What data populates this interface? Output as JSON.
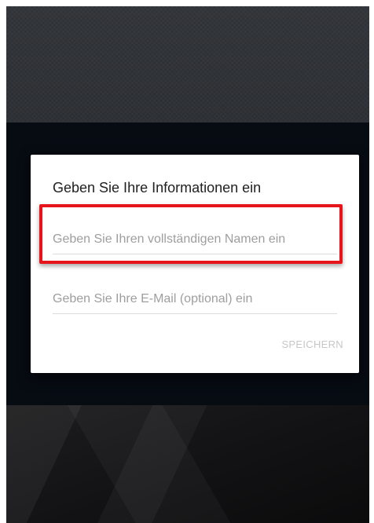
{
  "dialog": {
    "title": "Geben Sie Ihre Informationen ein",
    "name_field": {
      "value": "",
      "placeholder": "Geben Sie Ihren vollständigen Namen ein"
    },
    "email_field": {
      "value": "",
      "placeholder": "Geben Sie Ihre E-Mail (optional) ein"
    },
    "save_label": "SPEICHERN"
  },
  "colors": {
    "highlight": "#e8141c",
    "dialog_background": "#ffffff",
    "scrim": "#070b12",
    "save_disabled": "#c7c7c7"
  }
}
